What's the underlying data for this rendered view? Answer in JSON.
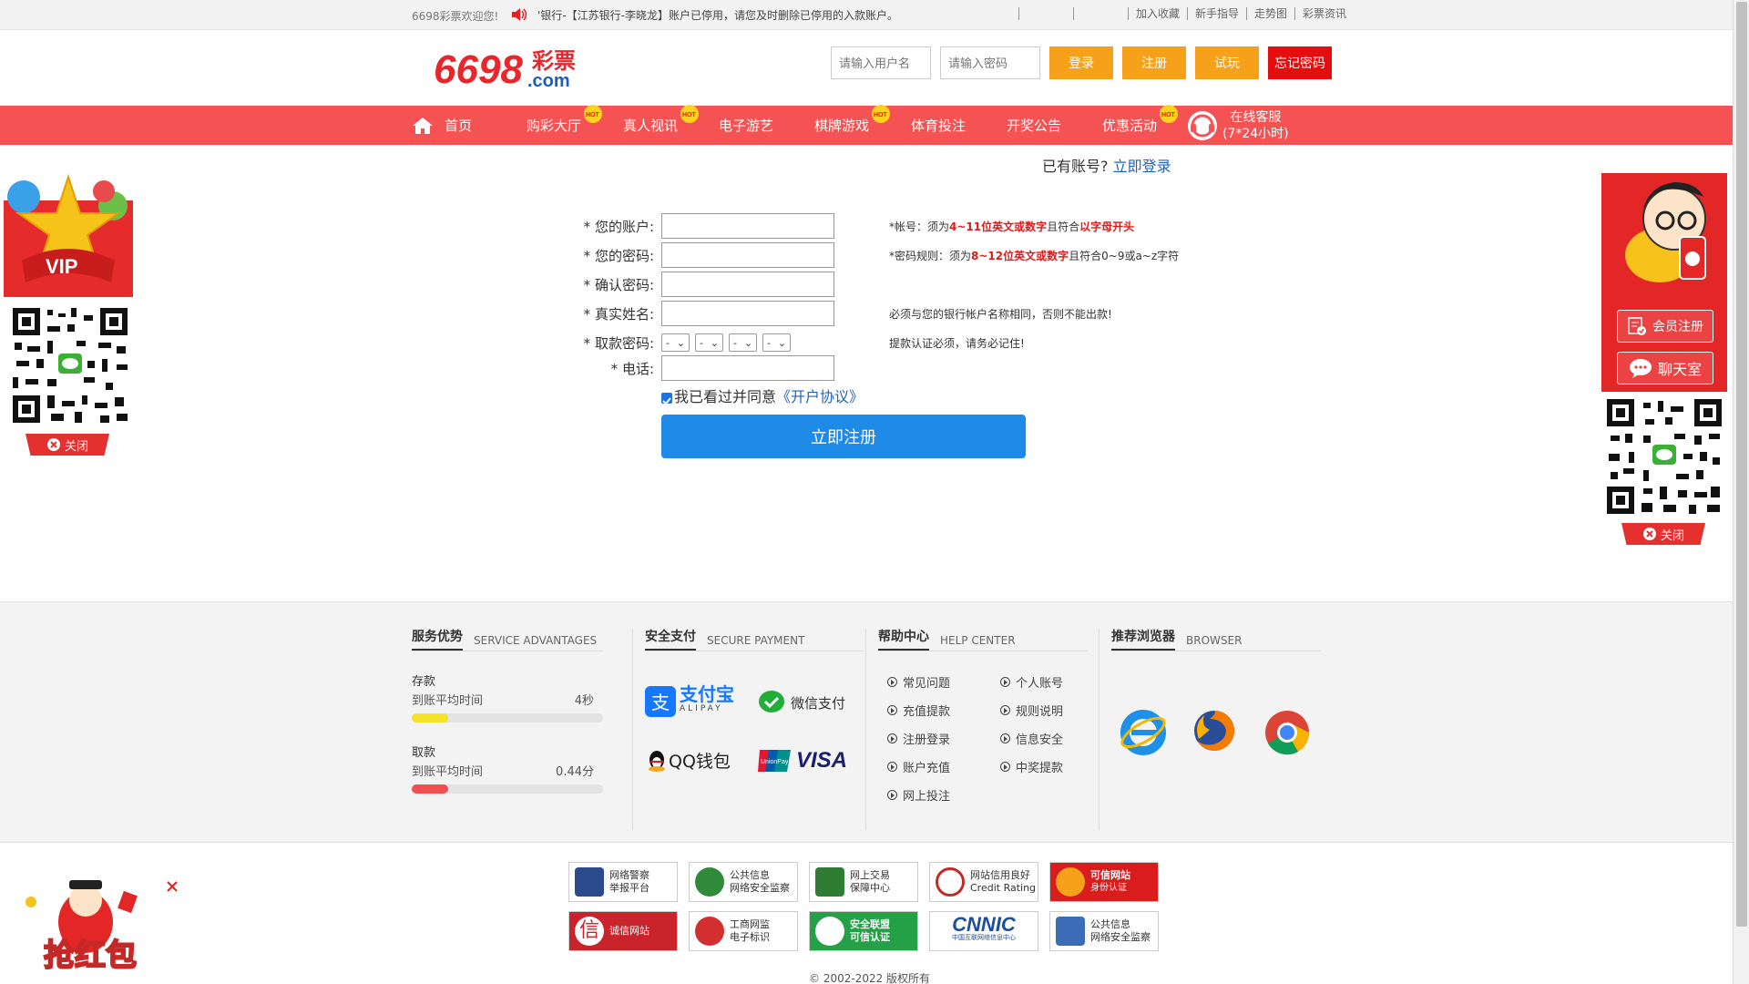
{
  "topbar": {
    "welcome": "6698彩票欢迎您!",
    "marquee": "'银行-【江苏银行-李晓龙】账户已停用，请您及时删除已停用的入款账户。",
    "links": [
      "加入收藏",
      "新手指导",
      "走势图",
      "彩票资讯"
    ]
  },
  "header": {
    "logo_text": "6698",
    "logo_cn": "彩票",
    "logo_com": ".com",
    "username_placeholder": "请输入用户名",
    "password_placeholder": "请输入密码",
    "login": "登录",
    "register": "注册",
    "trial": "试玩",
    "forgot": "忘记密码"
  },
  "nav": {
    "items": [
      "首页",
      "购彩大厅",
      "真人视讯",
      "电子游艺",
      "棋牌游戏",
      "体育投注",
      "开奖公告",
      "优惠活动"
    ],
    "hot_label": "HOT",
    "service_line1": "在线客服",
    "service_line2": "(7*24小时)"
  },
  "hint": {
    "text": "已有账号?",
    "link": "立即登录"
  },
  "form": {
    "labels": [
      "* 您的账户:",
      "* 您的密码:",
      "* 确认密码:",
      "* 真实姓名:",
      "* 取款密码:",
      "* 电话:"
    ],
    "select_value": "-",
    "tips": {
      "account_pre": "*帐号：须为",
      "account_red": "4~11位英文或数字",
      "account_mid": "且符合",
      "account_red2": "以字母开头",
      "password_pre": "*密码规则：须为",
      "password_red": "8~12位英文或数字",
      "password_post": "且符合0~9或a~z字符",
      "name": "必须与您的银行帐户名称相同，否则不能出款!",
      "withdraw": "提款认证必须，请务必记住!"
    },
    "agree_text": "我已看过并同意",
    "agree_link": "《开户协议》",
    "submit": "立即注册"
  },
  "float_left": {
    "vip": "VIP",
    "close": "关闭"
  },
  "float_right": {
    "register": "会员注册",
    "chat": "聊天室",
    "close": "关闭"
  },
  "footer": {
    "service": {
      "cn": "服务优势",
      "en": "SERVICE ADVANTAGES",
      "deposit": "存款",
      "deposit_sub": "到账平均时间",
      "deposit_val": "4秒",
      "deposit_fill": 0.19,
      "withdraw": "取款",
      "withdraw_sub": "到账平均时间",
      "withdraw_val": "0.44分",
      "withdraw_fill": 0.19
    },
    "payment": {
      "cn": "安全支付",
      "en": "SECURE PAYMENT",
      "alipay": "支付宝",
      "alipay_en": "ALIPAY",
      "wechat": "微信支付",
      "qq": "QQ钱包",
      "unionpay": "UnionPay",
      "visa": "VISA"
    },
    "help": {
      "cn": "帮助中心",
      "en": "HELP CENTER",
      "left": [
        "常见问题",
        "充值提款",
        "注册登录",
        "账户充值",
        "网上投注"
      ],
      "right": [
        "个人账号",
        "规则说明",
        "信息安全",
        "中奖提款"
      ]
    },
    "browser": {
      "cn": "推荐浏览器",
      "en": "BROWSER"
    }
  },
  "badges": [
    [
      "网络警察",
      "举报平台"
    ],
    [
      "公共信息",
      "网络安全监察"
    ],
    [
      "网上交易",
      "保障中心"
    ],
    [
      "网站信用良好",
      "Credit Rating"
    ],
    [
      "可信网站",
      "身份认证"
    ],
    [
      "诚信网站",
      ""
    ],
    [
      "工商网监",
      "电子标识"
    ],
    [
      "安全联盟",
      "可信认证"
    ],
    [
      "CNNIC",
      "中国互联网络信息中心"
    ],
    [
      "公共信息",
      "网络安全监察"
    ]
  ],
  "copyright": "© 2002-2022 版权所有",
  "redpack": "抢红包"
}
